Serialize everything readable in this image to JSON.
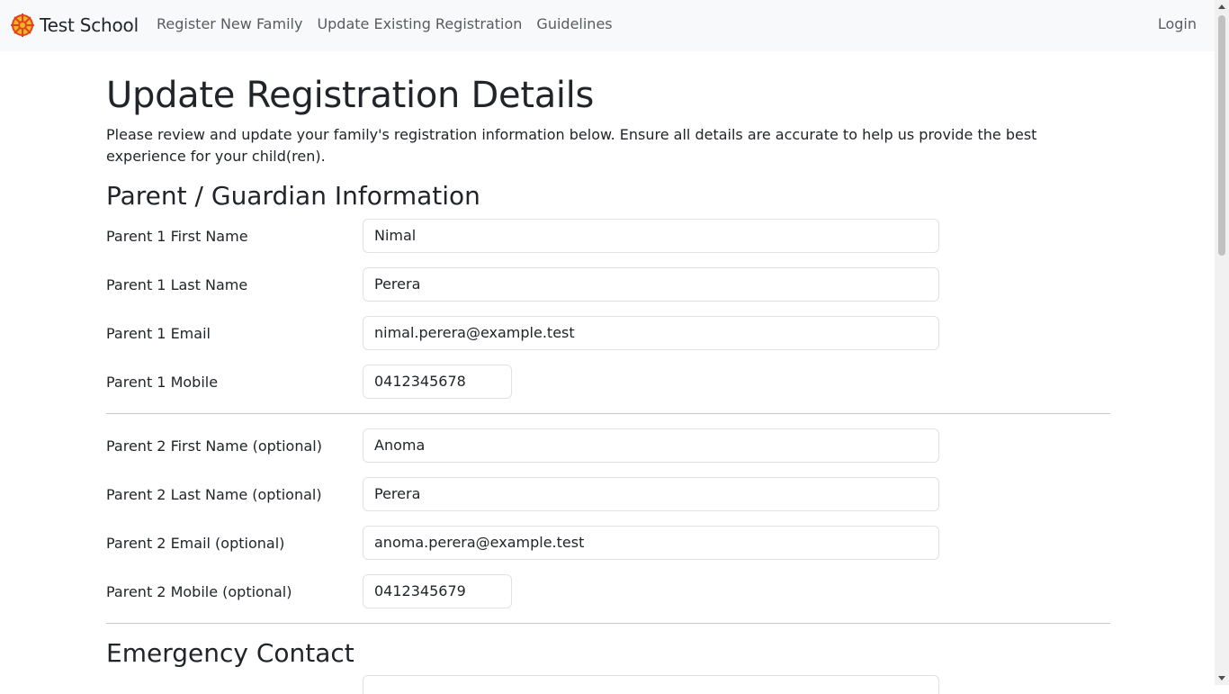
{
  "navbar": {
    "brand": "Test School",
    "links": [
      "Register New Family",
      "Update Existing Registration",
      "Guidelines"
    ],
    "login": "Login"
  },
  "page": {
    "title": "Update Registration Details",
    "intro": "Please review and update your family's registration information below. Ensure all details are accurate to help us provide the best experience for your child(ren)."
  },
  "parents": {
    "title": "Parent / Guardian Information",
    "fields": [
      {
        "label": "Parent 1 First Name",
        "value": "Nimal"
      },
      {
        "label": "Parent 1 Last Name",
        "value": "Perera"
      },
      {
        "label": "Parent 1 Email",
        "value": "nimal.perera@example.test"
      },
      {
        "label": "Parent 1 Mobile",
        "value": "0412345678"
      },
      {
        "label": "Parent 2 First Name (optional)",
        "value": "Anoma"
      },
      {
        "label": "Parent 2 Last Name (optional)",
        "value": "Perera"
      },
      {
        "label": "Parent 2 Email (optional)",
        "value": "anoma.perera@example.test"
      },
      {
        "label": "Parent 2 Mobile (optional)",
        "value": "0412345679"
      }
    ]
  },
  "emergency": {
    "title": "Emergency Contact"
  }
}
